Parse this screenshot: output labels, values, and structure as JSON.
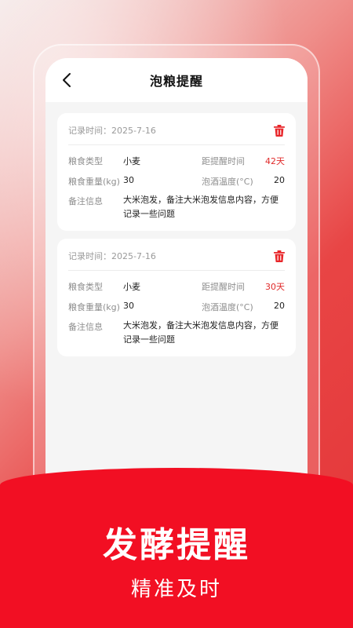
{
  "nav": {
    "title": "泡粮提醒"
  },
  "cards": [
    {
      "record_time": "记录时间：2025-7-16",
      "grain_type_label": "粮食类型",
      "grain_type": "小麦",
      "remind_label": "距提醒时间",
      "remind_value": "42天",
      "weight_label": "粮食重量(kg)",
      "weight": "30",
      "temp_label": "泡酒温度(°C)",
      "temp": "20",
      "note_label": "备注信息",
      "note": "大米泡发，备注大米泡发信息内容，方便记录一些问题"
    },
    {
      "record_time": "记录时间：2025-7-16",
      "grain_type_label": "粮食类型",
      "grain_type": "小麦",
      "remind_label": "距提醒时间",
      "remind_value": "30天",
      "weight_label": "粮食重量(kg)",
      "weight": "30",
      "temp_label": "泡酒温度(°C)",
      "temp": "20",
      "note_label": "备注信息",
      "note": "大米泡发，备注大米泡发信息内容，方便记录一些问题"
    }
  ],
  "promo": {
    "headline": "发酵提醒",
    "subline": "精准及时"
  },
  "colors": {
    "accent": "#f20f23",
    "remind": "#e02a2a"
  },
  "icons": {
    "back": "chevron-left-icon",
    "delete": "trash-icon"
  }
}
